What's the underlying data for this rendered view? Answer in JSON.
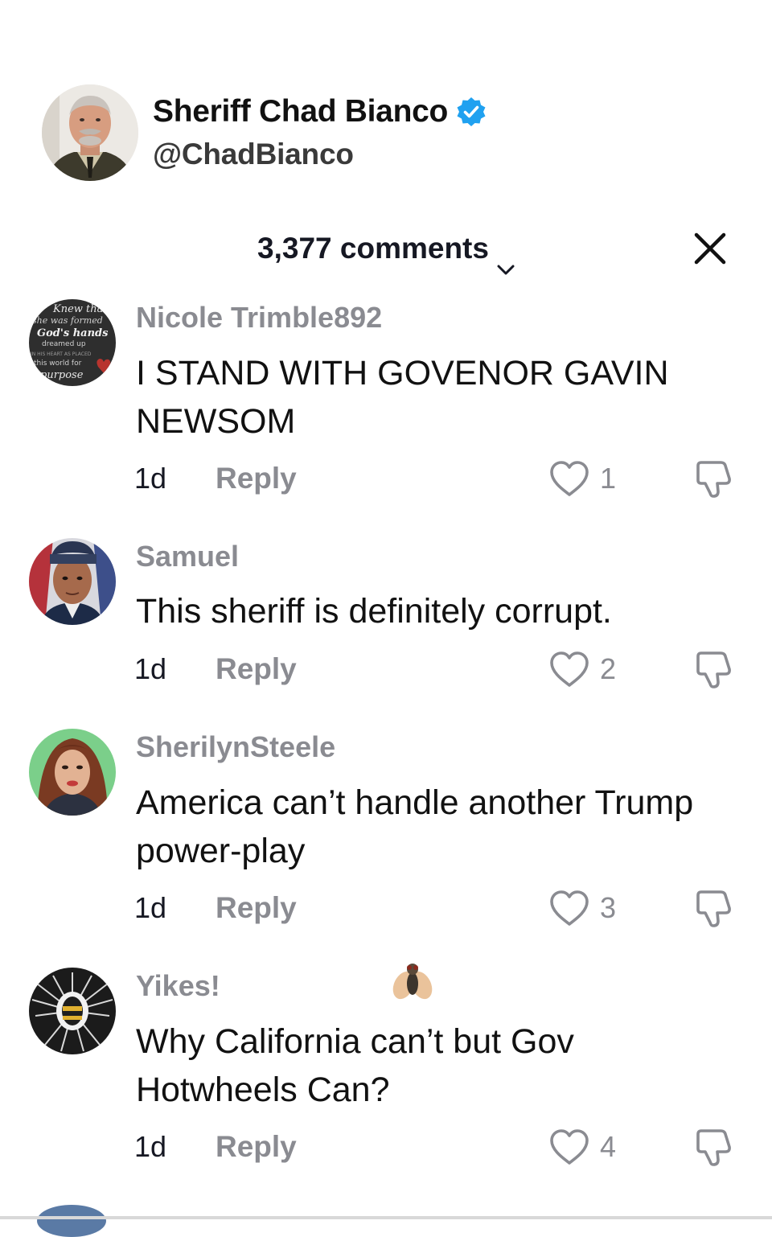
{
  "profile": {
    "name": "Sheriff Chad Bianco",
    "handle": "@ChadBianco",
    "verified": true
  },
  "comments_header": {
    "count_label": "3,377 comments"
  },
  "icons": {
    "verified": "verified-badge-icon",
    "chevron": "chevron-down-icon",
    "close": "close-icon",
    "like": "heart-icon",
    "dislike": "thumbs-down-icon",
    "fly": "fly-emoji-icon"
  },
  "colors": {
    "verified_blue": "#20a1f0",
    "muted_text": "#8a8b91",
    "primary_text": "#161823"
  },
  "comments": [
    {
      "username": "Nicole Trimble892",
      "text": "I STAND WITH GOVENOR GAVIN NEWSOM",
      "time": "1d",
      "reply_label": "Reply",
      "likes": "1",
      "avatar_text": [
        "Knew tha",
        "she was formed",
        "God's hands",
        "dreamed up",
        "IN HIS HEART AS PLACED",
        "this world for",
        "purpose"
      ]
    },
    {
      "username": "Samuel",
      "text": "This sheriff is definitely corrupt.",
      "time": "1d",
      "reply_label": "Reply",
      "likes": "2"
    },
    {
      "username": "SherilynSteele",
      "text": "America can’t handle another Trump power-play",
      "time": "1d",
      "reply_label": "Reply",
      "likes": "3"
    },
    {
      "username": "Yikes!",
      "text": "Why California can’t but Gov Hotwheels Can?",
      "time": "1d",
      "reply_label": "Reply",
      "likes": "4"
    }
  ]
}
